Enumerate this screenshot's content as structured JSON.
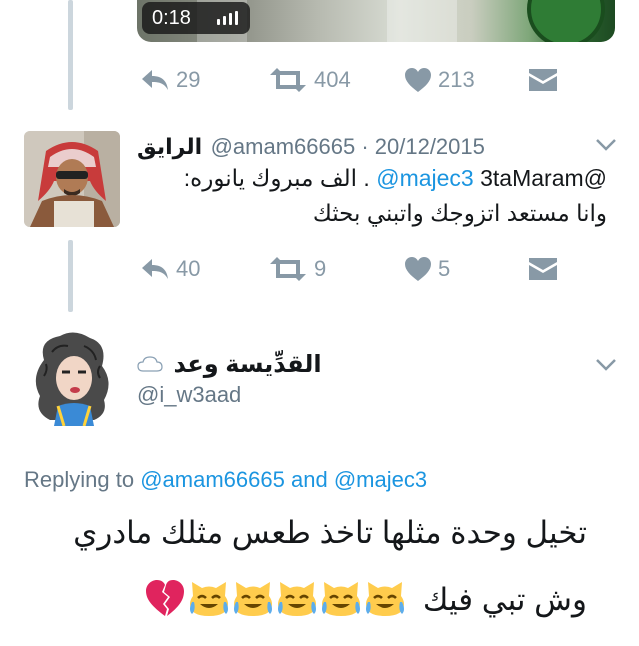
{
  "video": {
    "duration": "0:18"
  },
  "tweet1": {
    "actions": {
      "replies": "29",
      "retweets": "404",
      "likes": "213"
    }
  },
  "tweet2": {
    "display_name": "الرايق",
    "handle_date": "@amam66665 · 20/12/2015",
    "line1_mention1": "@majec3",
    "line1_rest": ". الف مبروك يانوره:",
    "line1_mention2": "3taMaram@",
    "line2": "وانا مستعد اتزوجك واتبني بحثك",
    "actions": {
      "replies": "40",
      "retweets": "9",
      "likes": "5"
    }
  },
  "tweet3": {
    "display_name": "القدِّيسة وعد",
    "cloud_emoji": "☁",
    "handle": "@i_w3aad",
    "replying_prefix": "Replying to",
    "replying_user1": "@amam66665",
    "replying_and": "and",
    "replying_user2": "@majec3",
    "line1": "تخيل وحدة مثلها تاخذ طعس مثلك مادري",
    "line2": "وش تبي فيك",
    "emojis": [
      "crying-laughing-cat",
      "crying-laughing-cat",
      "crying-laughing-cat",
      "crying-laughing-cat",
      "crying-laughing-cat",
      "broken-heart"
    ]
  },
  "colors": {
    "icon_gray": "#8899a6",
    "link_blue": "#1b95e0",
    "thread_line": "#ccd6dd"
  }
}
